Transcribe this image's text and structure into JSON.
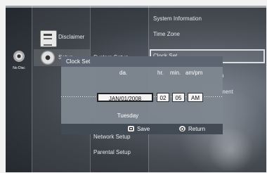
{
  "side": {
    "no_disc_label": "No Disc"
  },
  "main_menu": {
    "disclaimer": "Disclaimer",
    "setup": "Setup"
  },
  "setup_menu": {
    "system_setup": "System Setup",
    "network_setup": "Network Setup",
    "parental_setup": "Parental Setup"
  },
  "system_menu": {
    "system_information": "System Information",
    "time_zone": "Time Zone",
    "clock_set": "Clock Set",
    "partial_item_1": "n",
    "partial_item_2": "ment"
  },
  "dialog": {
    "title": "Clock Set",
    "headers": {
      "date": "da.",
      "hour": "hr.",
      "minute": "min.",
      "ampm": "am/pm"
    },
    "values": {
      "date": "JAN/01/2008",
      "hour": "02",
      "minute": "05",
      "ampm": "AM"
    },
    "day": "Tuesday",
    "save_label": "Save",
    "return_label": "Return"
  }
}
